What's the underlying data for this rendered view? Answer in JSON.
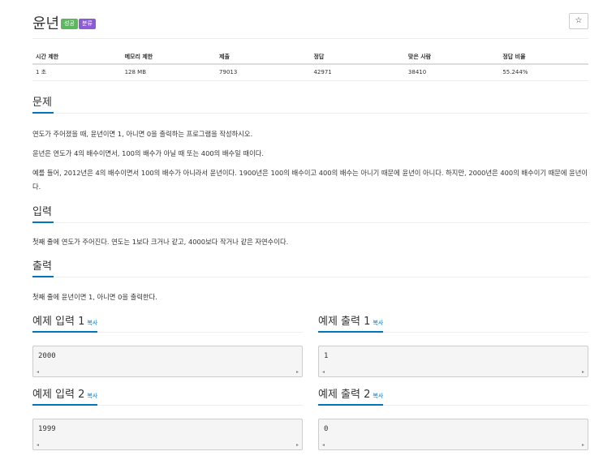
{
  "problem": {
    "title": "윤년",
    "badges": {
      "result": "성공",
      "category": "분류"
    },
    "star": "☆"
  },
  "stats": {
    "headers": [
      "시간 제한",
      "메모리 제한",
      "제출",
      "정답",
      "맞은 사람",
      "정답 비율"
    ],
    "values": [
      "1 초",
      "128 MB",
      "79013",
      "42971",
      "38410",
      "55.244%"
    ]
  },
  "sections": {
    "problem": {
      "heading": "문제",
      "paragraphs": [
        "연도가 주어졌을 때, 윤년이면 1, 아니면 0을 출력하는 프로그램을 작성하시오.",
        "윤년은 연도가 4의 배수이면서, 100의 배수가 아닐 때 또는 400의 배수일 때이다.",
        "예를 들어, 2012년은 4의 배수이면서 100의 배수가 아니라서 윤년이다. 1900년은 100의 배수이고 400의 배수는 아니기 때문에 윤년이 아니다. 하지만, 2000년은 400의 배수이기 때문에 윤년이다."
      ]
    },
    "input": {
      "heading": "입력",
      "text": "첫째 줄에 연도가 주어진다. 연도는 1보다 크거나 같고, 4000보다 작거나 같은 자연수이다."
    },
    "output": {
      "heading": "출력",
      "text": "첫째 줄에 윤년이면 1, 아니면 0을 출력한다."
    }
  },
  "examples": {
    "copy_label": "복사",
    "in1": {
      "heading": "예제 입력 1",
      "value": "2000"
    },
    "out1": {
      "heading": "예제 출력 1",
      "value": "1"
    },
    "in2": {
      "heading": "예제 입력 2",
      "value": "1999"
    },
    "out2": {
      "heading": "예제 출력 2",
      "value": "0"
    }
  },
  "scroll_icons": {
    "left": "◂",
    "right": "▸"
  }
}
